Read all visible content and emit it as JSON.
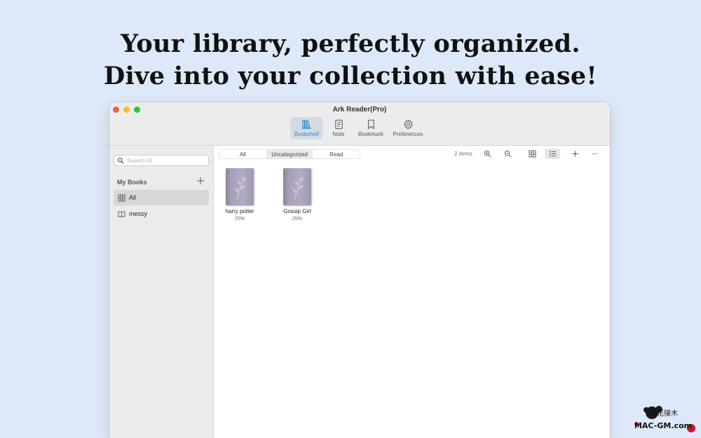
{
  "headline": {
    "line1": "Your library, perfectly organized.",
    "line2": "Dive into your collection with ease!"
  },
  "window": {
    "title": "Ark Reader(Pro)",
    "toolbar": [
      {
        "label": "Bookshelf",
        "icon": "bookshelf-icon",
        "active": true
      },
      {
        "label": "Note",
        "icon": "note-icon",
        "active": false
      },
      {
        "label": "Bookmark",
        "icon": "bookmark-icon",
        "active": false
      },
      {
        "label": "Preferences",
        "icon": "gear-icon",
        "active": false
      }
    ]
  },
  "sidebar": {
    "search_placeholder": "Search All",
    "section_title": "My Books",
    "items": [
      {
        "label": "All",
        "icon": "grid-icon",
        "selected": true
      },
      {
        "label": "messy",
        "icon": "open-book-icon",
        "selected": false
      }
    ]
  },
  "content": {
    "filters": [
      {
        "label": "All",
        "active": false
      },
      {
        "label": "Uncategorized",
        "active": true
      },
      {
        "label": "Read",
        "active": false
      }
    ],
    "item_count": "2 items",
    "books": [
      {
        "title": "harry potter",
        "progress": "25%"
      },
      {
        "title": "Gossip Girl",
        "progress": "25%"
      }
    ]
  },
  "colors": {
    "background": "#dde9f8",
    "accent": "#2f8fd0",
    "close": "#ee5f57",
    "minimize": "#f5bd2f",
    "maximize": "#28c840"
  },
  "watermark": {
    "text": "梅花接木 MAC-GM.com"
  }
}
